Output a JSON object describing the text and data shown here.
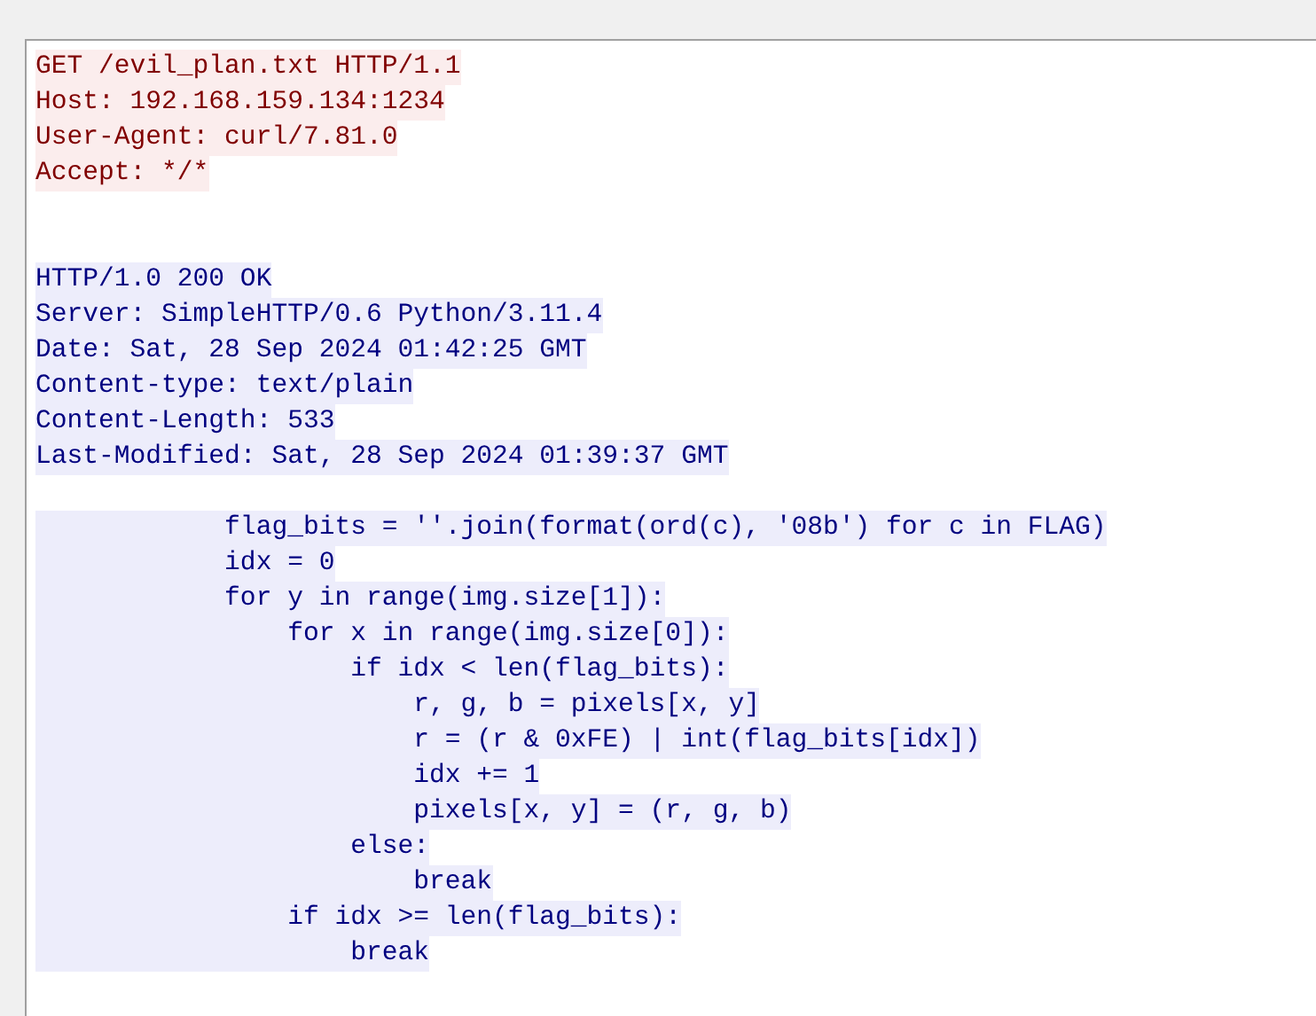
{
  "stream": [
    {
      "kind": "client",
      "lines": [
        "GET /evil_plan.txt HTTP/1.1",
        "Host: 192.168.159.134:1234",
        "User-Agent: curl/7.81.0",
        "Accept: */*"
      ]
    },
    {
      "kind": "server",
      "lines": [
        "HTTP/1.0 200 OK",
        "Server: SimpleHTTP/0.6 Python/3.11.4",
        "Date: Sat, 28 Sep 2024 01:42:25 GMT",
        "Content-type: text/plain",
        "Content-Length: 533",
        "Last-Modified: Sat, 28 Sep 2024 01:39:37 GMT"
      ]
    },
    {
      "kind": "server",
      "lines": [
        "            flag_bits = ''.join(format(ord(c), '08b') for c in FLAG)",
        "            idx = 0",
        "            for y in range(img.size[1]):",
        "                for x in range(img.size[0]):",
        "                    if idx < len(flag_bits):",
        "                        r, g, b = pixels[x, y]",
        "                        r = (r & 0xFE) | int(flag_bits[idx])",
        "                        idx += 1",
        "                        pixels[x, y] = (r, g, b)",
        "                    else:",
        "                        break",
        "                if idx >= len(flag_bits):",
        "                    break"
      ]
    }
  ]
}
